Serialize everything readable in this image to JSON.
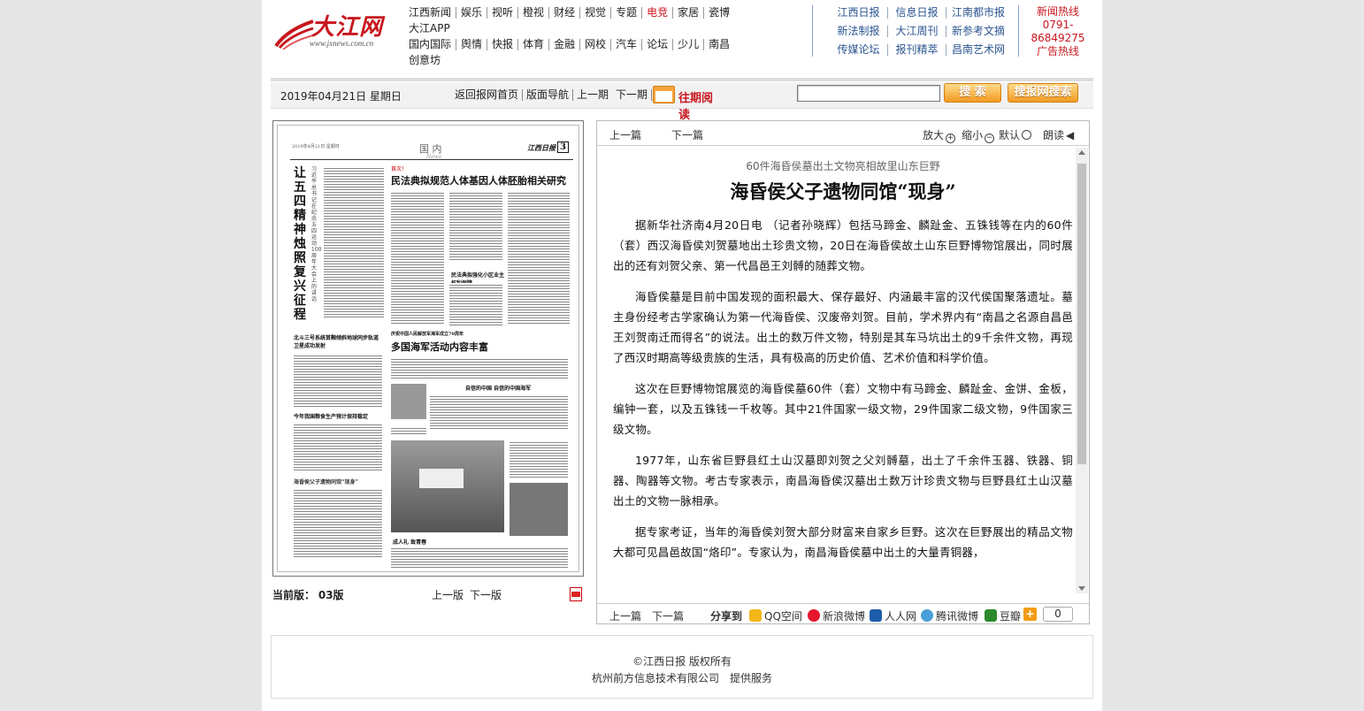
{
  "logo": {
    "text": "大江网",
    "url": "www.jxnews.com.cn"
  },
  "nav": {
    "row1": [
      "江西新闻",
      "娱乐",
      "视听",
      "橙视",
      "财经",
      "视觉",
      "专题",
      "电竞",
      "家居",
      "瓷博",
      "大江APP"
    ],
    "row2": [
      "国内国际",
      "舆情",
      "快报",
      "体育",
      "金融",
      "网校",
      "汽车",
      "论坛",
      "少儿",
      "南昌",
      "创意坊"
    ],
    "highlight": "电竞"
  },
  "papers": {
    "row1": [
      "江西日报",
      "信息日报",
      "江南都市报"
    ],
    "row2": [
      "新法制报",
      "大江周刊",
      "新参考文摘"
    ],
    "row3": [
      "传媒论坛",
      "报刊精萃",
      "昌南艺术网"
    ]
  },
  "hotline": {
    "l1": "新闻热线",
    "l2": "0791-",
    "l3": "86849275",
    "l4": "广告热线"
  },
  "toolbar": {
    "date": "2019年04月21日 星期日",
    "links": [
      "返回报网首页",
      "版面导航",
      "上一期",
      "下一期"
    ],
    "archive": "往期阅读",
    "search_btn": "搜 索",
    "paper_search_btn": "搜报网搜索"
  },
  "thumb": {
    "header_date": "2019年4月21日 星期日",
    "section": "国 内",
    "section_en": "News",
    "paper": "江西日报",
    "page": "3",
    "kicker": "首次！",
    "headline": "民法典拟规范人体基因人体胚胎相关研究",
    "vert_title": "让五四精神烛照复兴征程",
    "vert_sub": "习近平总书记在纪念五四运动100周年大会上的讲话",
    "h2_kicker": "庆祝中国人民解放军海军成立70周年",
    "h2": "多国海军活动内容丰富",
    "h3": "自信的中国 自信的中国海军",
    "h4": "民法典拟强化小区业主权利保障",
    "h5": "北斗三号系统首颗倾斜地球同步轨道卫星成功发射",
    "h6": "今年我国粮食生产预计保持稳定",
    "h7": "海昏侯父子遗物同馆“现身”",
    "caption": "成人礼 致青春"
  },
  "current": {
    "label": "当前版：",
    "page": "03版",
    "prev": "上一版",
    "next": "下一版"
  },
  "article": {
    "prev": "上一篇",
    "next": "下一篇",
    "zoom_in": "放大",
    "zoom_out": "缩小",
    "default": "默认",
    "read": "朗读",
    "subtitle": "60件海昏侯墓出土文物亮相故里山东巨野",
    "title": "海昏侯父子遗物同馆“现身”",
    "paragraphs": [
      "据新华社济南4月20日电 （记者孙晓辉）包括马蹄金、麟趾金、五铢钱等在内的60件（套）西汉海昏侯刘贺墓地出土珍贵文物，20日在海昏侯故土山东巨野博物馆展出，同时展出的还有刘贺父亲、第一代昌邑王刘髆的随葬文物。",
      "海昏侯墓是目前中国发现的面积最大、保存最好、内涵最丰富的汉代侯国聚落遗址。墓主身份经考古学家确认为第一代海昏侯、汉废帝刘贺。目前，学术界内有“南昌之名源自昌邑王刘贺南迁而得名”的说法。出土的数万件文物，特别是其车马坑出土的9千余件文物，再现了西汉时期高等级贵族的生活，具有极高的历史价值、艺术价值和科学价值。",
      "这次在巨野博物馆展览的海昏侯墓60件（套）文物中有马蹄金、麟趾金、金饼、金板，编钟一套，以及五铢钱一千枚等。其中21件国家一级文物，29件国家二级文物，9件国家三级文物。",
      "1977年，山东省巨野县红土山汉墓即刘贺之父刘髆墓，出土了千余件玉器、铁器、铜器、陶器等文物。考古专家表示，南昌海昏侯汉墓出土数万计珍贵文物与巨野县红土山汉墓出土的文物一脉相承。",
      "据专家考证，当年的海昏侯刘贺大部分财富来自家乡巨野。这次在巨野展出的精品文物大都可见昌邑故国“烙印”。专家认为，南昌海昏侯墓中出土的大量青铜器，"
    ],
    "share_label": "分享到",
    "share": [
      "QQ空间",
      "新浪微博",
      "人人网",
      "腾讯微博",
      "豆瓣"
    ],
    "count": "0"
  },
  "footer": {
    "l1": "©江西日报 版权所有",
    "l2": "杭州前方信息技术有限公司　提供服务"
  }
}
